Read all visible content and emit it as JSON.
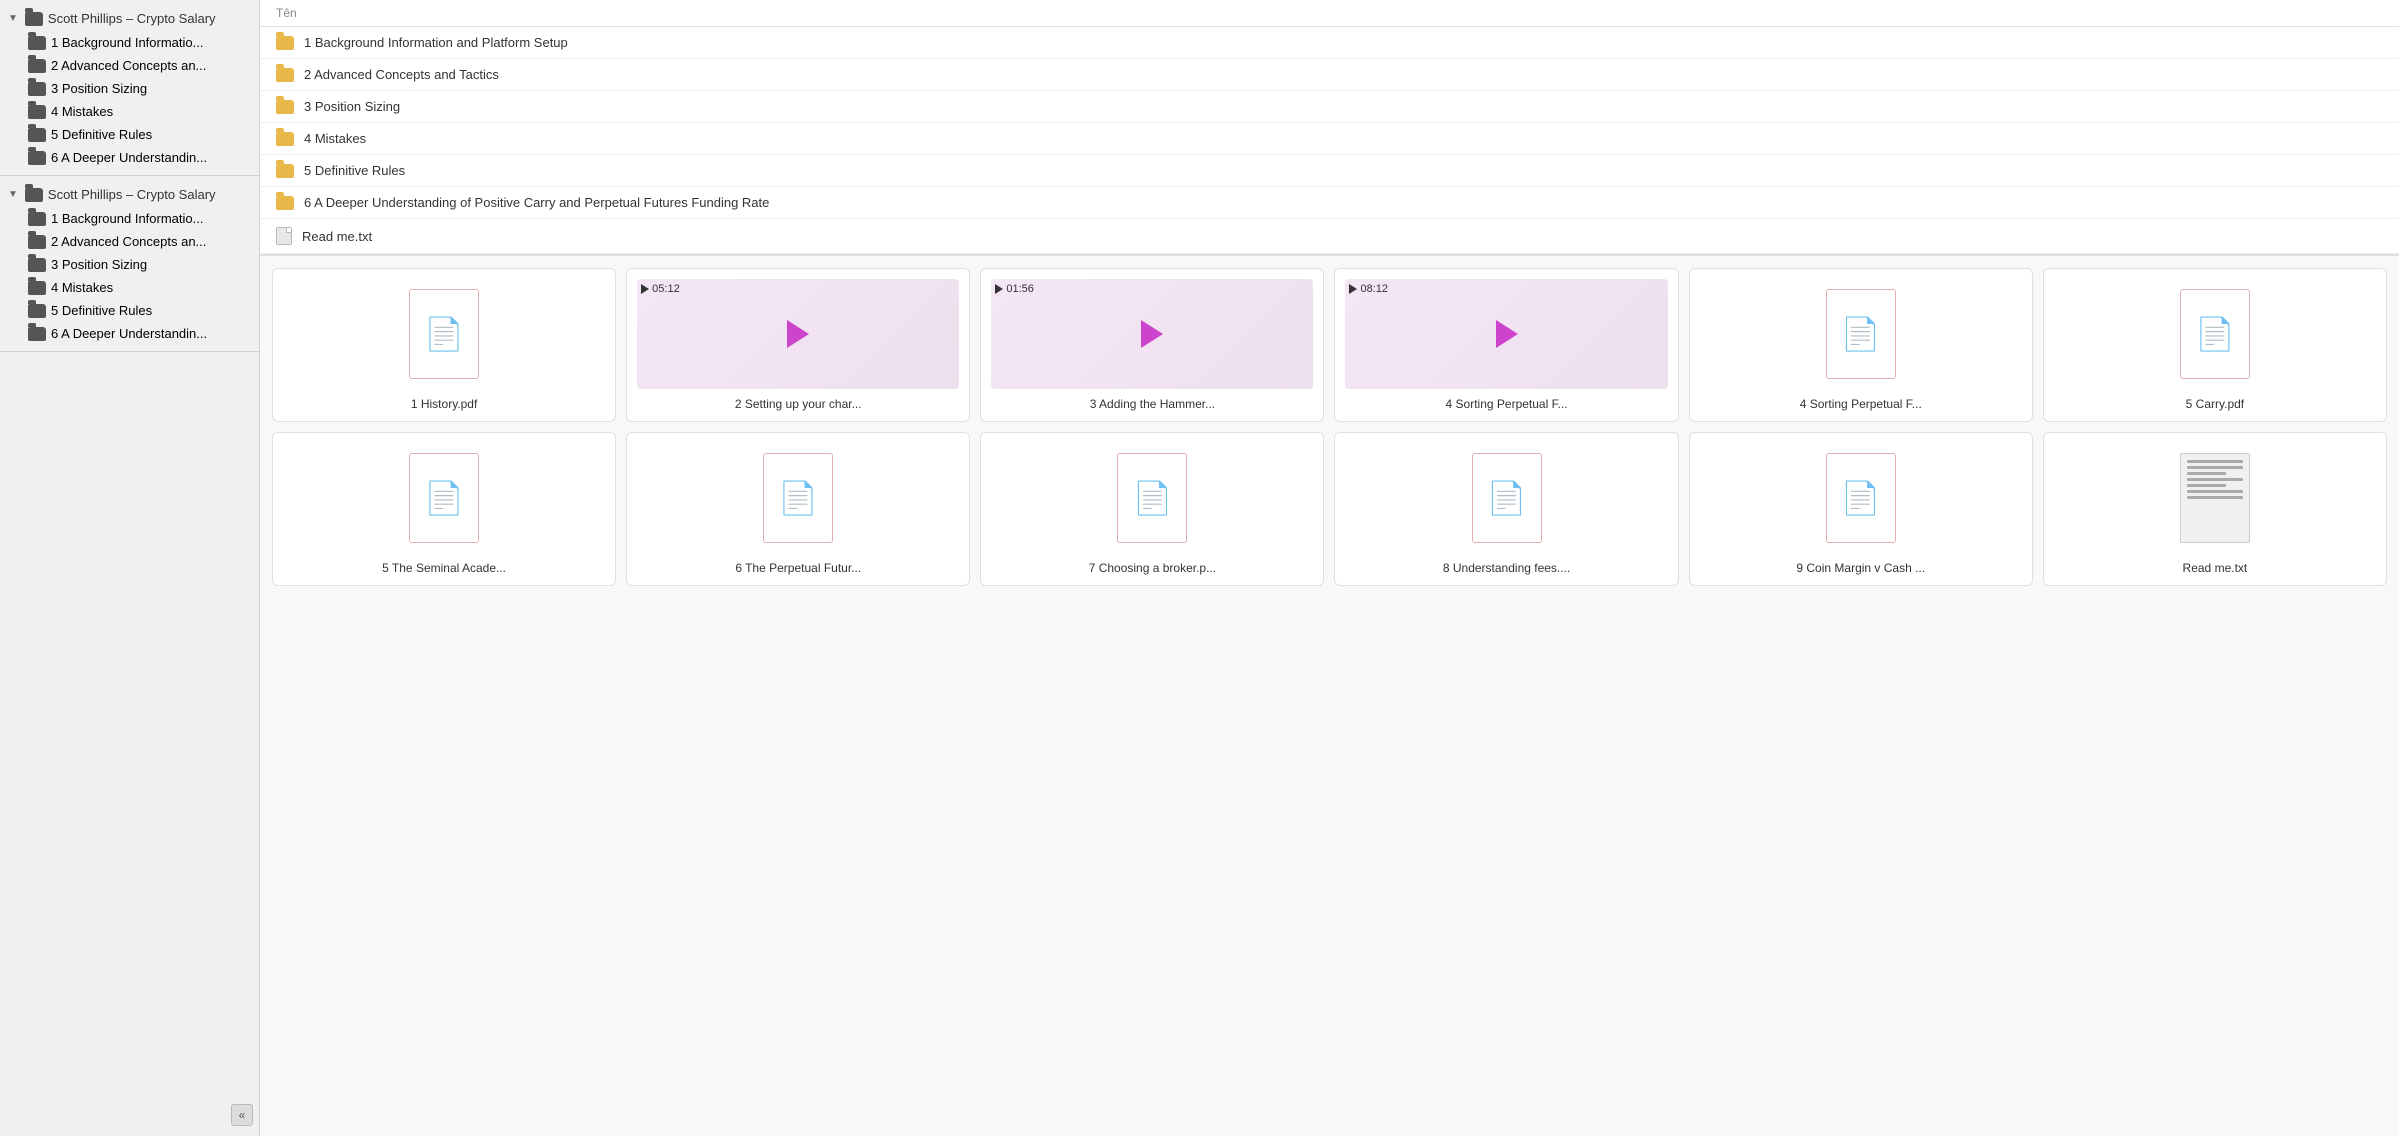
{
  "sidebar": {
    "section1": {
      "root_label": "Scott Phillips – Crypto Salary",
      "items": [
        "1 Background Informatio...",
        "2 Advanced Concepts an...",
        "3 Position Sizing",
        "4 Mistakes",
        "5 Definitive Rules",
        "6 A Deeper Understandin..."
      ]
    },
    "section2": {
      "root_label": "Scott Phillips – Crypto Salary",
      "items": [
        "1 Background Informatio...",
        "2 Advanced Concepts an...",
        "3 Position Sizing",
        "4 Mistakes",
        "5 Definitive Rules",
        "6 A Deeper Understandin..."
      ]
    },
    "collapse_label": "«"
  },
  "list_header": "Tên",
  "list_rows": [
    {
      "type": "folder",
      "label": "1 Background Information and Platform Setup"
    },
    {
      "type": "folder",
      "label": "2 Advanced Concepts and Tactics"
    },
    {
      "type": "folder",
      "label": "3 Position Sizing"
    },
    {
      "type": "folder",
      "label": "4 Mistakes"
    },
    {
      "type": "folder",
      "label": "5 Definitive Rules"
    },
    {
      "type": "folder",
      "label": "6 A Deeper Understanding of Positive Carry and Perpetual Futures Funding Rate"
    },
    {
      "type": "txt",
      "label": "Read me.txt"
    }
  ],
  "grid_items": [
    {
      "type": "pdf",
      "label": "1 History.pdf",
      "duration": null
    },
    {
      "type": "video",
      "label": "2 Setting up your char...",
      "duration": "05:12"
    },
    {
      "type": "video",
      "label": "3 Adding the Hammer...",
      "duration": "01:56"
    },
    {
      "type": "video",
      "label": "4 Sorting Perpetual F...",
      "duration": "08:12"
    },
    {
      "type": "pdf",
      "label": "4 Sorting Perpetual F...",
      "duration": null
    },
    {
      "type": "pdf",
      "label": "5 Carry.pdf",
      "duration": null
    },
    {
      "type": "pdf",
      "label": "5 The Seminal Acade...",
      "duration": null
    },
    {
      "type": "pdf",
      "label": "6 The Perpetual Futur...",
      "duration": null
    },
    {
      "type": "pdf",
      "label": "7 Choosing a broker.p...",
      "duration": null
    },
    {
      "type": "pdf",
      "label": "8 Understanding fees....",
      "duration": null
    },
    {
      "type": "pdf",
      "label": "9 Coin Margin v Cash ...",
      "duration": null
    },
    {
      "type": "txt",
      "label": "Read me.txt",
      "duration": null
    }
  ]
}
